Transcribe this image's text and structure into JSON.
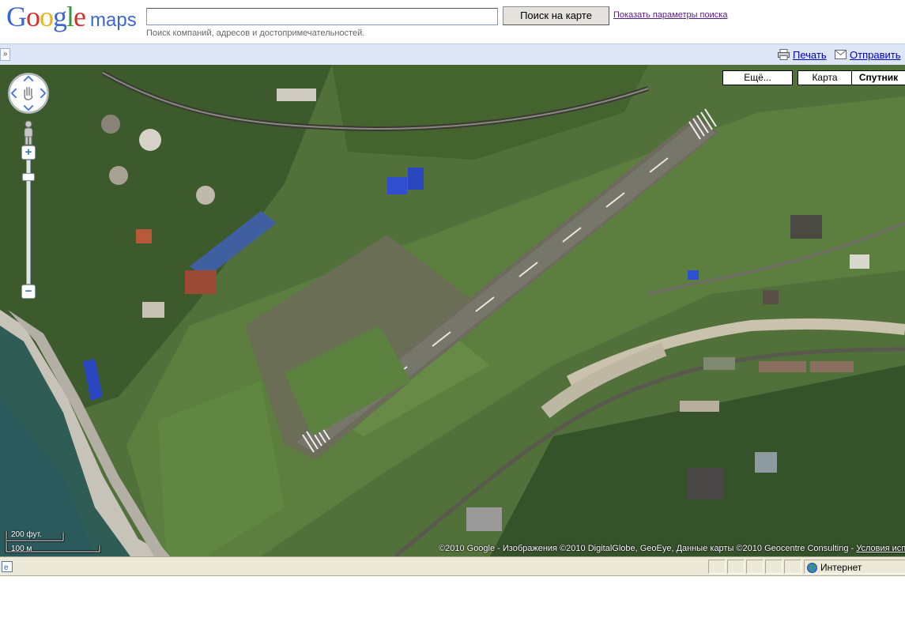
{
  "header": {
    "logo_letters": [
      "G",
      "o",
      "o",
      "g",
      "l",
      "e"
    ],
    "logo_maps": "maps",
    "search_value": "",
    "search_button": "Поиск на карте",
    "options_link": "Показать параметры поиска",
    "hint": "Поиск компаний, адресов и достопримечательностей."
  },
  "toolbar": {
    "expand": "»",
    "print": "Печать",
    "send": "Отправить"
  },
  "map": {
    "types": {
      "more": "Ещё...",
      "map": "Карта",
      "satellite": "Спутник",
      "selected": "satellite"
    },
    "scale_ft": "200 фут.",
    "scale_m": "100 м",
    "copyright": "©2010 Google - Изображения ©2010 DigitalGlobe, GeoEye, Данные карты ©2010 Geocentre Consulting - ",
    "terms_link": "Условия испо",
    "zoom_in": "+",
    "zoom_out": "−"
  },
  "statusbar": {
    "zone": "Интернет"
  },
  "colors": {
    "toolbar_bg": "#dde6f7",
    "link": "#0000cc",
    "visited_link": "#551a8b",
    "status_bg": "#ece9d8"
  }
}
